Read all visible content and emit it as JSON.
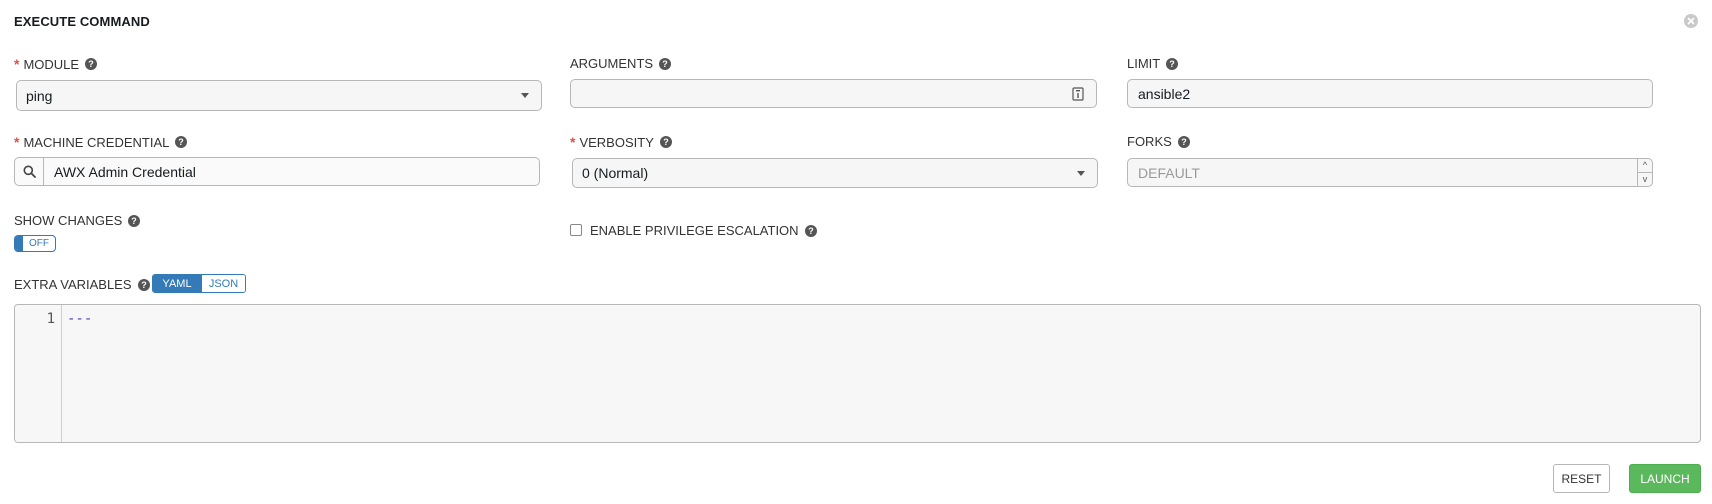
{
  "dialog": {
    "title": "EXECUTE COMMAND"
  },
  "fields": {
    "module": {
      "label": "MODULE",
      "value": "ping",
      "required": true
    },
    "arguments": {
      "label": "ARGUMENTS",
      "value": ""
    },
    "limit": {
      "label": "LIMIT",
      "value": "ansible2"
    },
    "machine_credential": {
      "label": "MACHINE CREDENTIAL",
      "value": "AWX Admin Credential",
      "required": true
    },
    "verbosity": {
      "label": "VERBOSITY",
      "value": "0 (Normal)",
      "required": true
    },
    "forks": {
      "label": "FORKS",
      "placeholder": "DEFAULT",
      "up": "^",
      "down": "v"
    },
    "show_changes": {
      "label": "SHOW CHANGES",
      "toggle": "OFF"
    },
    "privilege_escalation": {
      "label": "ENABLE PRIVILEGE ESCALATION",
      "checked": false
    },
    "extra_variables": {
      "label": "EXTRA VARIABLES",
      "modes": [
        "YAML",
        "JSON"
      ],
      "active_mode": "YAML",
      "lines": [
        {
          "number": "1",
          "text": "---"
        }
      ]
    }
  },
  "required_marker": "*",
  "actions": {
    "reset": "RESET",
    "launch": "LAUNCH"
  },
  "colors": {
    "accent": "#337ab7",
    "required": "#d9534f",
    "launch": "#5cb85c"
  },
  "icons": {
    "help": "question-circle-icon",
    "close": "close-circle-icon",
    "lookup": "search-icon"
  }
}
